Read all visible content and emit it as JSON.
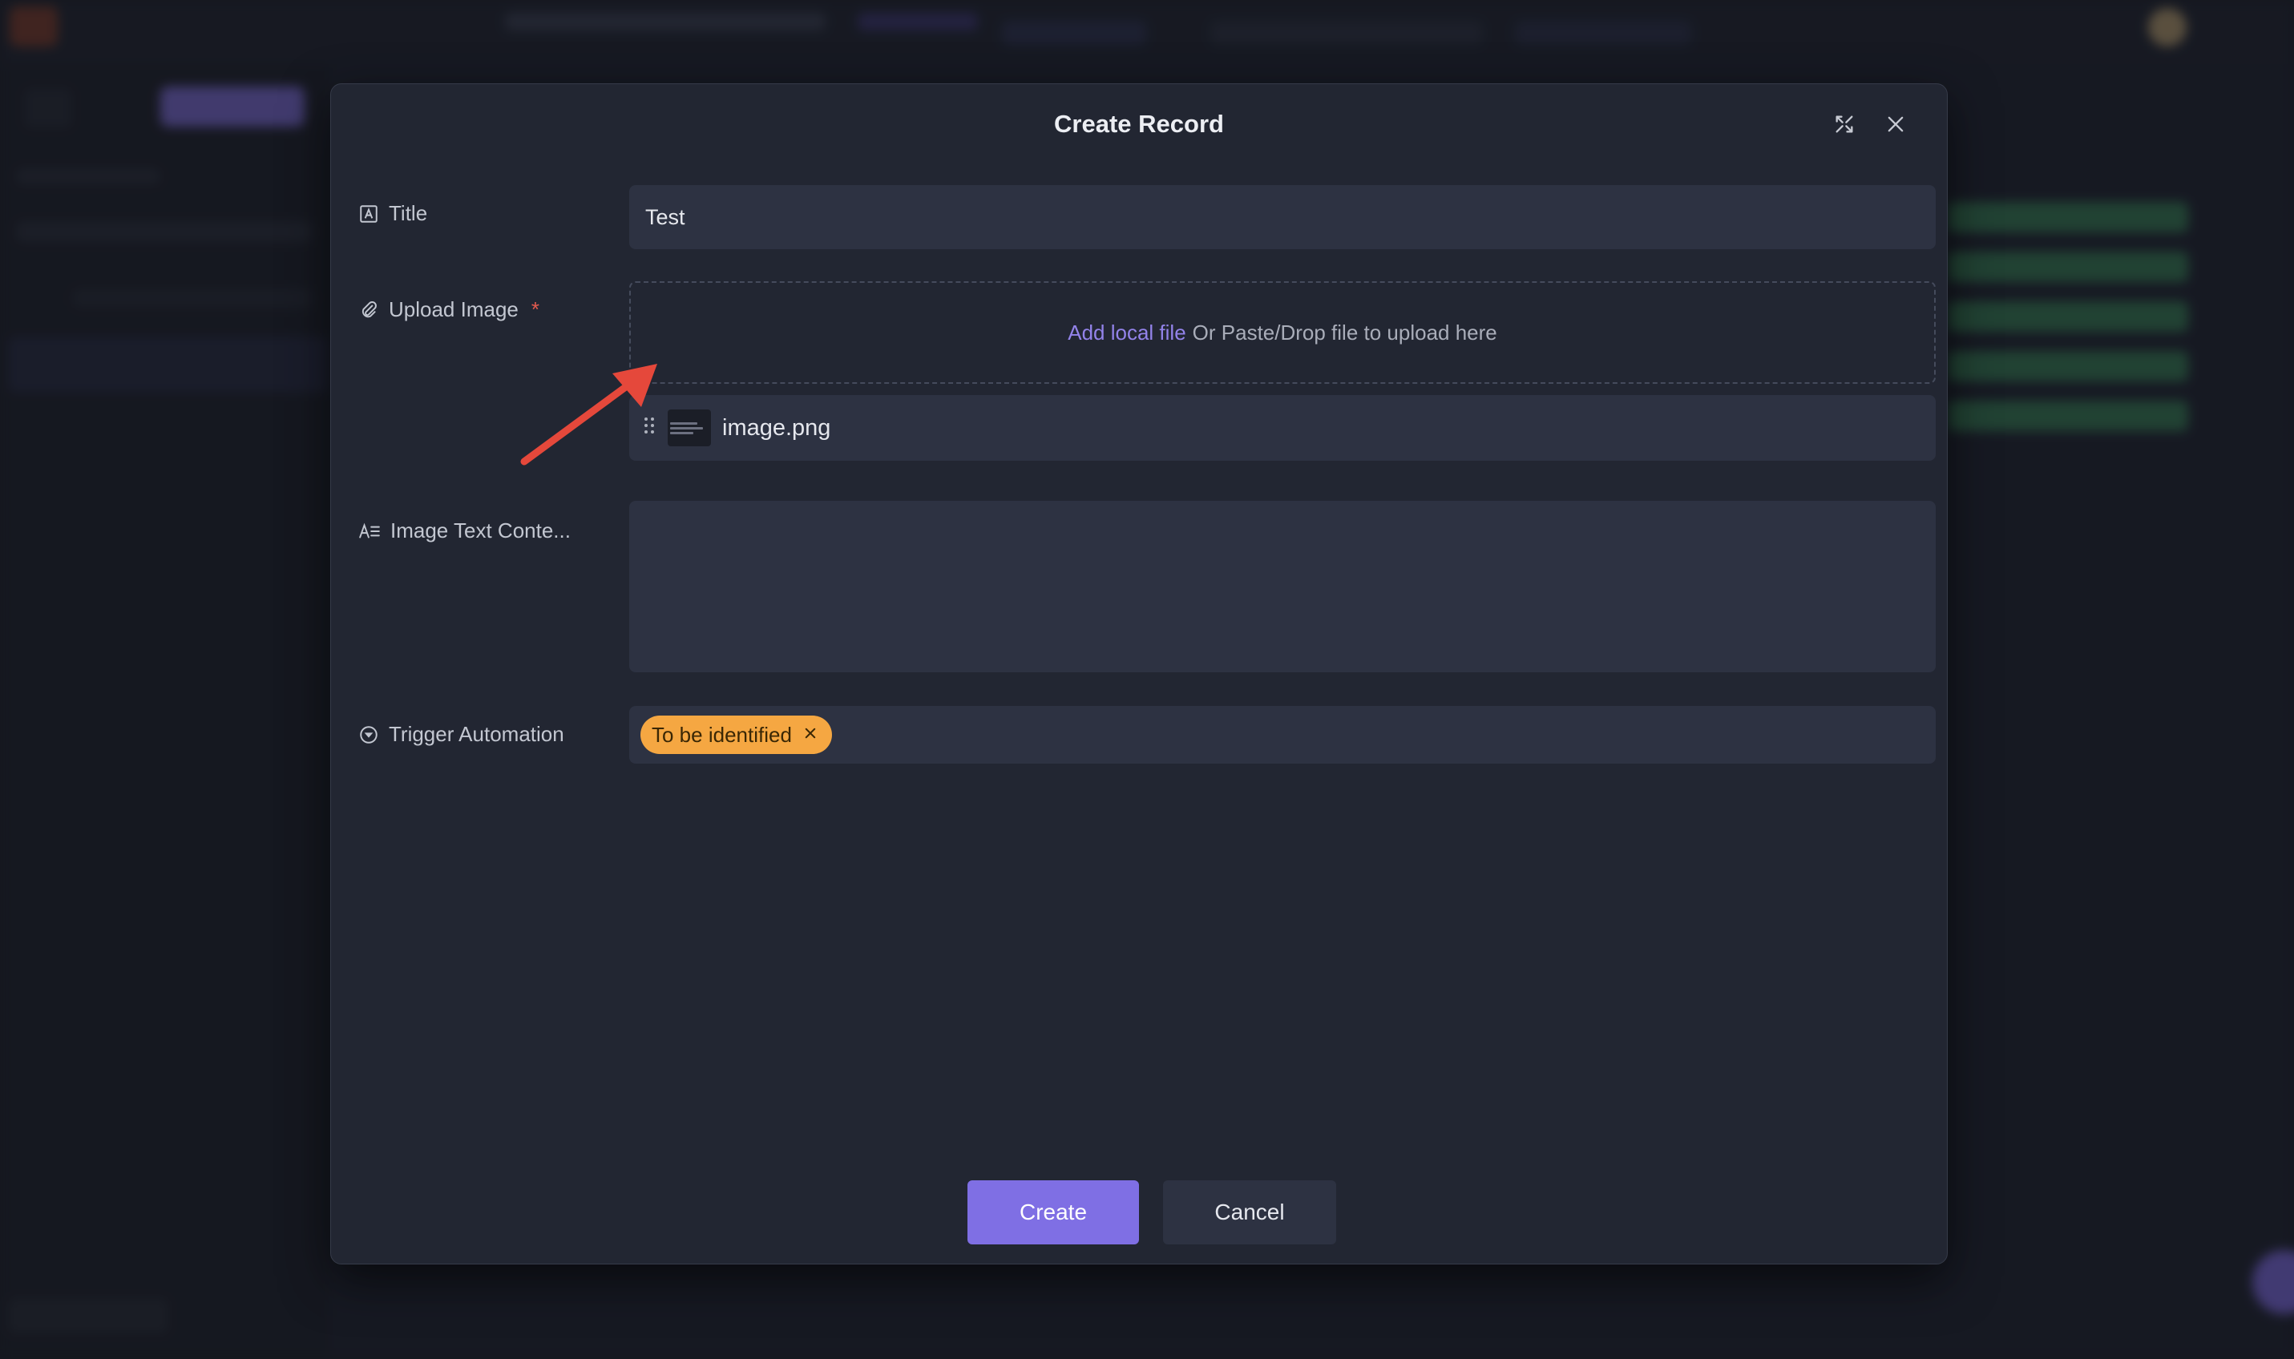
{
  "modal": {
    "title": "Create Record",
    "expand_icon": "expand-icon",
    "close_icon": "close-icon"
  },
  "fields": {
    "title": {
      "label": "Title",
      "icon": "text-field-icon",
      "value": "Test"
    },
    "upload_image": {
      "label": "Upload Image",
      "required_mark": "*",
      "icon": "paperclip-icon",
      "add_link": "Add local file",
      "drop_hint": "Or Paste/Drop file to upload here",
      "file": {
        "name": "image.png",
        "drag_icon": "drag-handle-icon"
      }
    },
    "image_text_content": {
      "label": "Image Text Conte...",
      "icon": "long-text-icon",
      "value": ""
    },
    "trigger_automation": {
      "label": "Trigger Automation",
      "icon": "single-select-icon",
      "selected_tag": "To be identified",
      "tag_remove_icon": "close-icon"
    }
  },
  "buttons": {
    "create": "Create",
    "cancel": "Cancel"
  },
  "colors": {
    "modal_bg": "#222632",
    "input_bg": "#2d3242",
    "accent": "#7f6fe4",
    "link": "#9383ea",
    "tag": "#f5a742",
    "required": "#e45b4f",
    "annotation_arrow": "#e5483b"
  }
}
